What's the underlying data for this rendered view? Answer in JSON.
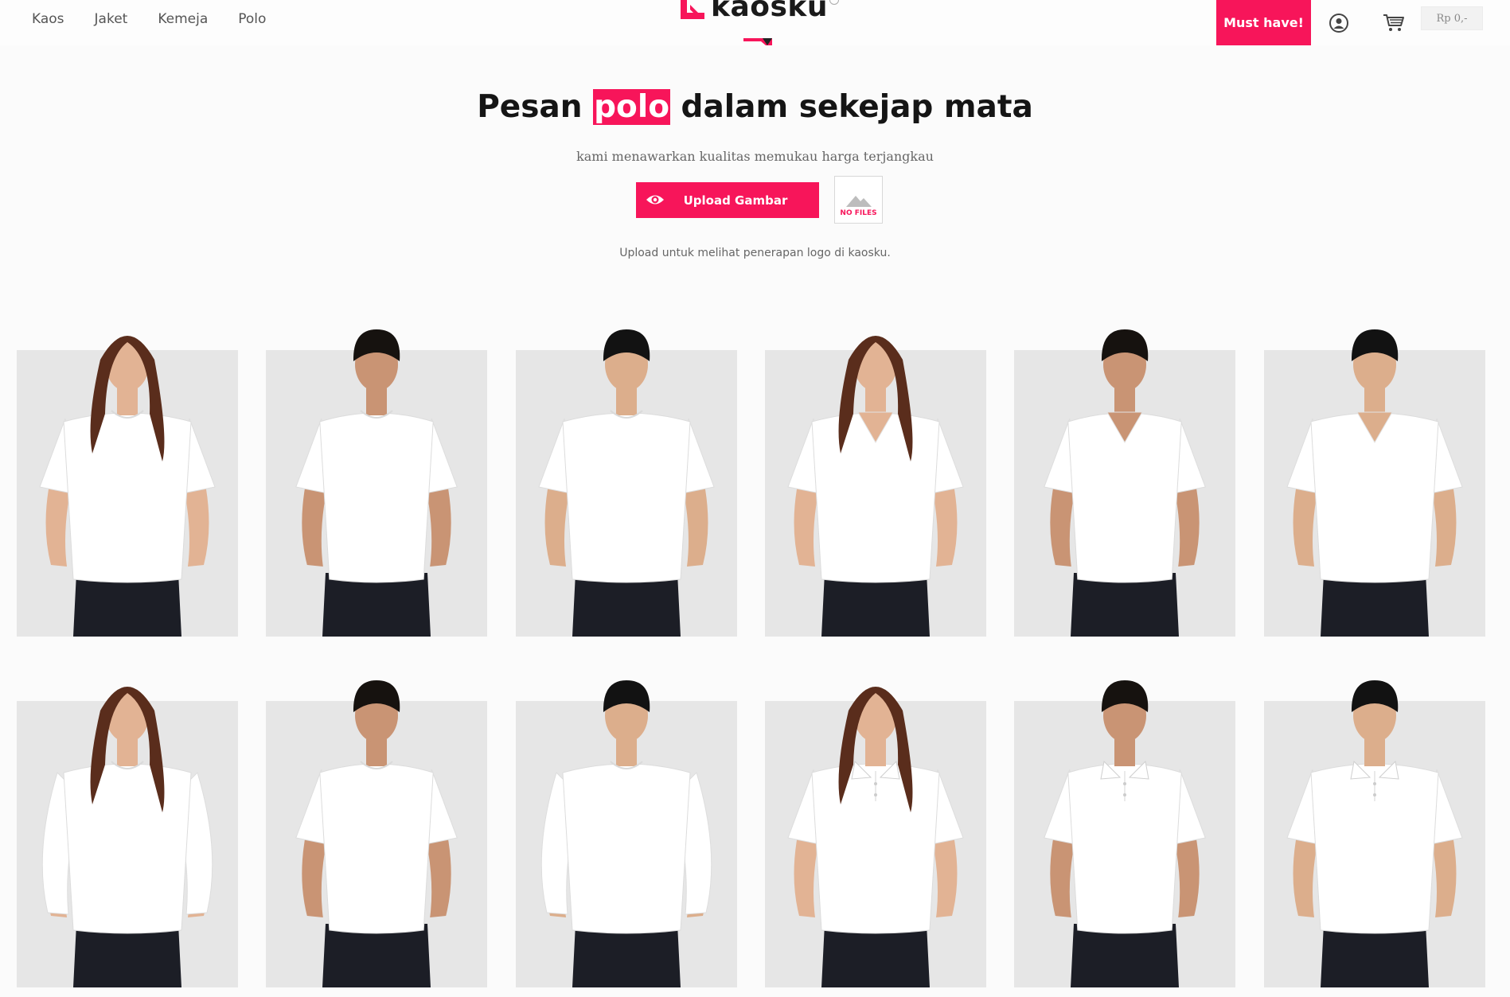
{
  "nav": {
    "links": [
      "Kaos",
      "Jaket",
      "Kemeja",
      "Polo"
    ],
    "logo_text": "kaosku",
    "must_have_label": "Must have!",
    "cart_total": "Rp 0,-",
    "icons": [
      "user-circle-icon",
      "cart-icon"
    ]
  },
  "hero": {
    "title_before": "Pesan ",
    "title_highlight": "polo",
    "title_after": " dalam sekejap mata",
    "subtitle": "kami menawarkan kualitas memukau harga terjangkau",
    "upload_label": "Upload Gambar",
    "no_files_label": "NO FILES",
    "note": "Upload untuk melihat penerapan logo di kaosku."
  },
  "colors": {
    "accent": "#f7155a",
    "card_bg": "#e6e6e6",
    "shirt": "#ffffff",
    "pants": "#1c1e26"
  },
  "products": [
    {
      "model": "woman",
      "style": "tshirt-crew",
      "sleeve": "short"
    },
    {
      "model": "boy",
      "style": "tshirt-crew",
      "sleeve": "short"
    },
    {
      "model": "man",
      "style": "tshirt-crew",
      "sleeve": "short"
    },
    {
      "model": "woman",
      "style": "tshirt-vneck",
      "sleeve": "short"
    },
    {
      "model": "boy",
      "style": "tshirt-vneck",
      "sleeve": "short"
    },
    {
      "model": "man",
      "style": "tshirt-vneck",
      "sleeve": "short"
    },
    {
      "model": "woman",
      "style": "tshirt-crew",
      "sleeve": "long"
    },
    {
      "model": "boy",
      "style": "raglan",
      "sleeve": "short"
    },
    {
      "model": "man",
      "style": "tshirt-crew",
      "sleeve": "long"
    },
    {
      "model": "woman",
      "style": "polo",
      "sleeve": "short"
    },
    {
      "model": "boy",
      "style": "polo",
      "sleeve": "short"
    },
    {
      "model": "man",
      "style": "polo",
      "sleeve": "short"
    }
  ]
}
